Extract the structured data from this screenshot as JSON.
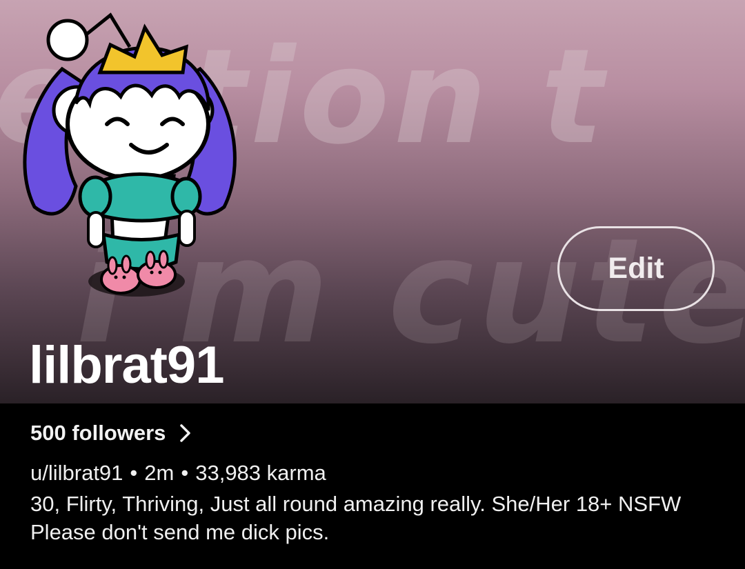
{
  "banner": {
    "text_line1": "ention t",
    "text_line2": "i'm cute"
  },
  "profile": {
    "display_name": "lilbrat91",
    "edit_label": "Edit",
    "followers_label": "500 followers",
    "username": "u/lilbrat91",
    "separator": "•",
    "account_age": "2m",
    "karma": "33,983 karma",
    "bio": "30, Flirty, Thriving, Just all round amazing really. She/Her 18+ NSFW Please don't send me dick pics."
  },
  "icons": {
    "avatar": "avatar-icon",
    "followers_chevron": "chevron-right-icon"
  },
  "colors": {
    "background": "#000000",
    "banner_top": "#c7a3b2",
    "banner_bottom": "#2a2127",
    "avatar_hair": "#6a4fe0",
    "avatar_outfit": "#2fb8a8",
    "avatar_slippers": "#f08aa8"
  }
}
